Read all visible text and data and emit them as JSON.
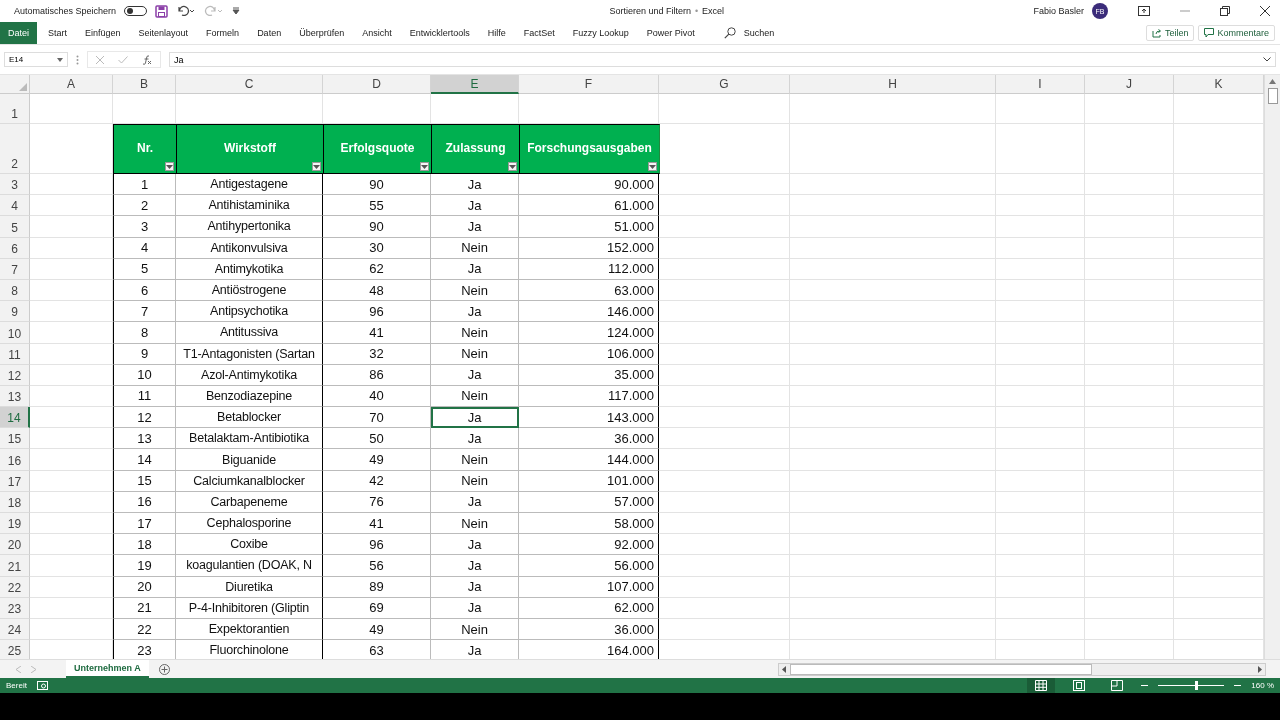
{
  "title_bar": {
    "autosave_label": "Automatisches Speichern",
    "autosave_on": false,
    "document_title": "Sortieren und Filtern",
    "separator": "•",
    "app_name": "Excel",
    "user_name": "Fabio Basler",
    "user_initials": "FB"
  },
  "ribbon_tabs": [
    {
      "label": "Datei",
      "selected": true
    },
    {
      "label": "Start",
      "selected": false
    },
    {
      "label": "Einfügen",
      "selected": false
    },
    {
      "label": "Seitenlayout",
      "selected": false
    },
    {
      "label": "Formeln",
      "selected": false
    },
    {
      "label": "Daten",
      "selected": false
    },
    {
      "label": "Überprüfen",
      "selected": false
    },
    {
      "label": "Ansicht",
      "selected": false
    },
    {
      "label": "Entwicklertools",
      "selected": false
    },
    {
      "label": "Hilfe",
      "selected": false
    },
    {
      "label": "FactSet",
      "selected": false
    },
    {
      "label": "Fuzzy Lookup",
      "selected": false
    },
    {
      "label": "Power Pivot",
      "selected": false
    }
  ],
  "search": {
    "placeholder": "Suchen"
  },
  "ribbon_buttons": [
    "Teilen",
    "Kommentare"
  ],
  "formula_bar": {
    "name_box": "E14",
    "value": "Ja"
  },
  "column_headers": [
    {
      "label": "A",
      "selected": false
    },
    {
      "label": "B",
      "selected": false
    },
    {
      "label": "C",
      "selected": false
    },
    {
      "label": "D",
      "selected": false
    },
    {
      "label": "E",
      "selected": true
    },
    {
      "label": "F",
      "selected": false
    },
    {
      "label": "G",
      "selected": false
    },
    {
      "label": "H",
      "selected": false
    },
    {
      "label": "I",
      "selected": false
    },
    {
      "label": "J",
      "selected": false
    },
    {
      "label": "K",
      "selected": false
    }
  ],
  "table": {
    "header_row": "2",
    "columns": [
      "Nr.",
      "Wirkstoff",
      "Erfolgsquote",
      "Zulassung",
      "Forschungsausgaben"
    ],
    "rows": [
      {
        "row": "3",
        "cells": [
          "1",
          "Antigestagene",
          "90",
          "Ja",
          "90.000"
        ],
        "selected": false
      },
      {
        "row": "4",
        "cells": [
          "2",
          "Antihistaminika",
          "55",
          "Ja",
          "61.000"
        ],
        "selected": false
      },
      {
        "row": "5",
        "cells": [
          "3",
          "Antihypertonika",
          "90",
          "Ja",
          "51.000"
        ],
        "selected": false
      },
      {
        "row": "6",
        "cells": [
          "4",
          "Antikonvulsiva",
          "30",
          "Nein",
          "152.000"
        ],
        "selected": false
      },
      {
        "row": "7",
        "cells": [
          "5",
          "Antimykotika",
          "62",
          "Ja",
          "112.000"
        ],
        "selected": false
      },
      {
        "row": "8",
        "cells": [
          "6",
          "Antiöstrogene",
          "48",
          "Nein",
          "63.000"
        ],
        "selected": false
      },
      {
        "row": "9",
        "cells": [
          "7",
          "Antipsychotika",
          "96",
          "Ja",
          "146.000"
        ],
        "selected": false
      },
      {
        "row": "10",
        "cells": [
          "8",
          "Antitussiva",
          "41",
          "Nein",
          "124.000"
        ],
        "selected": false
      },
      {
        "row": "11",
        "cells": [
          "9",
          "T1-Antagonisten (Sartan",
          "32",
          "Nein",
          "106.000"
        ],
        "selected": false
      },
      {
        "row": "12",
        "cells": [
          "10",
          "Azol-Antimykotika",
          "86",
          "Ja",
          "35.000"
        ],
        "selected": false
      },
      {
        "row": "13",
        "cells": [
          "11",
          "Benzodiazepine",
          "40",
          "Nein",
          "117.000"
        ],
        "selected": false
      },
      {
        "row": "14",
        "cells": [
          "12",
          "Betablocker",
          "70",
          "Ja",
          "143.000"
        ],
        "selected": true
      },
      {
        "row": "15",
        "cells": [
          "13",
          "Betalaktam-Antibiotika",
          "50",
          "Ja",
          "36.000"
        ],
        "selected": false
      },
      {
        "row": "16",
        "cells": [
          "14",
          "Biguanide",
          "49",
          "Nein",
          "144.000"
        ],
        "selected": false
      },
      {
        "row": "17",
        "cells": [
          "15",
          "Calciumkanalblocker",
          "42",
          "Nein",
          "101.000"
        ],
        "selected": false
      },
      {
        "row": "18",
        "cells": [
          "16",
          "Carbapeneme",
          "76",
          "Ja",
          "57.000"
        ],
        "selected": false
      },
      {
        "row": "19",
        "cells": [
          "17",
          "Cephalosporine",
          "41",
          "Nein",
          "58.000"
        ],
        "selected": false
      },
      {
        "row": "20",
        "cells": [
          "18",
          "Coxibe",
          "96",
          "Ja",
          "92.000"
        ],
        "selected": false
      },
      {
        "row": "21",
        "cells": [
          "19",
          "koagulantien (DOAK, N",
          "56",
          "Ja",
          "56.000"
        ],
        "selected": false
      },
      {
        "row": "22",
        "cells": [
          "20",
          "Diuretika",
          "89",
          "Ja",
          "107.000"
        ],
        "selected": false
      },
      {
        "row": "23",
        "cells": [
          "21",
          "P-4-Inhibitoren (Gliptin",
          "69",
          "Ja",
          "62.000"
        ],
        "selected": false
      },
      {
        "row": "24",
        "cells": [
          "22",
          "Expektorantien",
          "49",
          "Nein",
          "36.000"
        ],
        "selected": false
      },
      {
        "row": "25",
        "cells": [
          "23",
          "Fluorchinolone",
          "63",
          "Ja",
          "164.000"
        ],
        "selected": false
      }
    ]
  },
  "first_row": "1",
  "sheet_tabs": [
    {
      "label": "Unternehmen A",
      "selected": true
    }
  ],
  "status_bar": {
    "status": "Bereit",
    "zoom": "160 %",
    "zoom_slider": {
      "level": 0.57
    }
  }
}
